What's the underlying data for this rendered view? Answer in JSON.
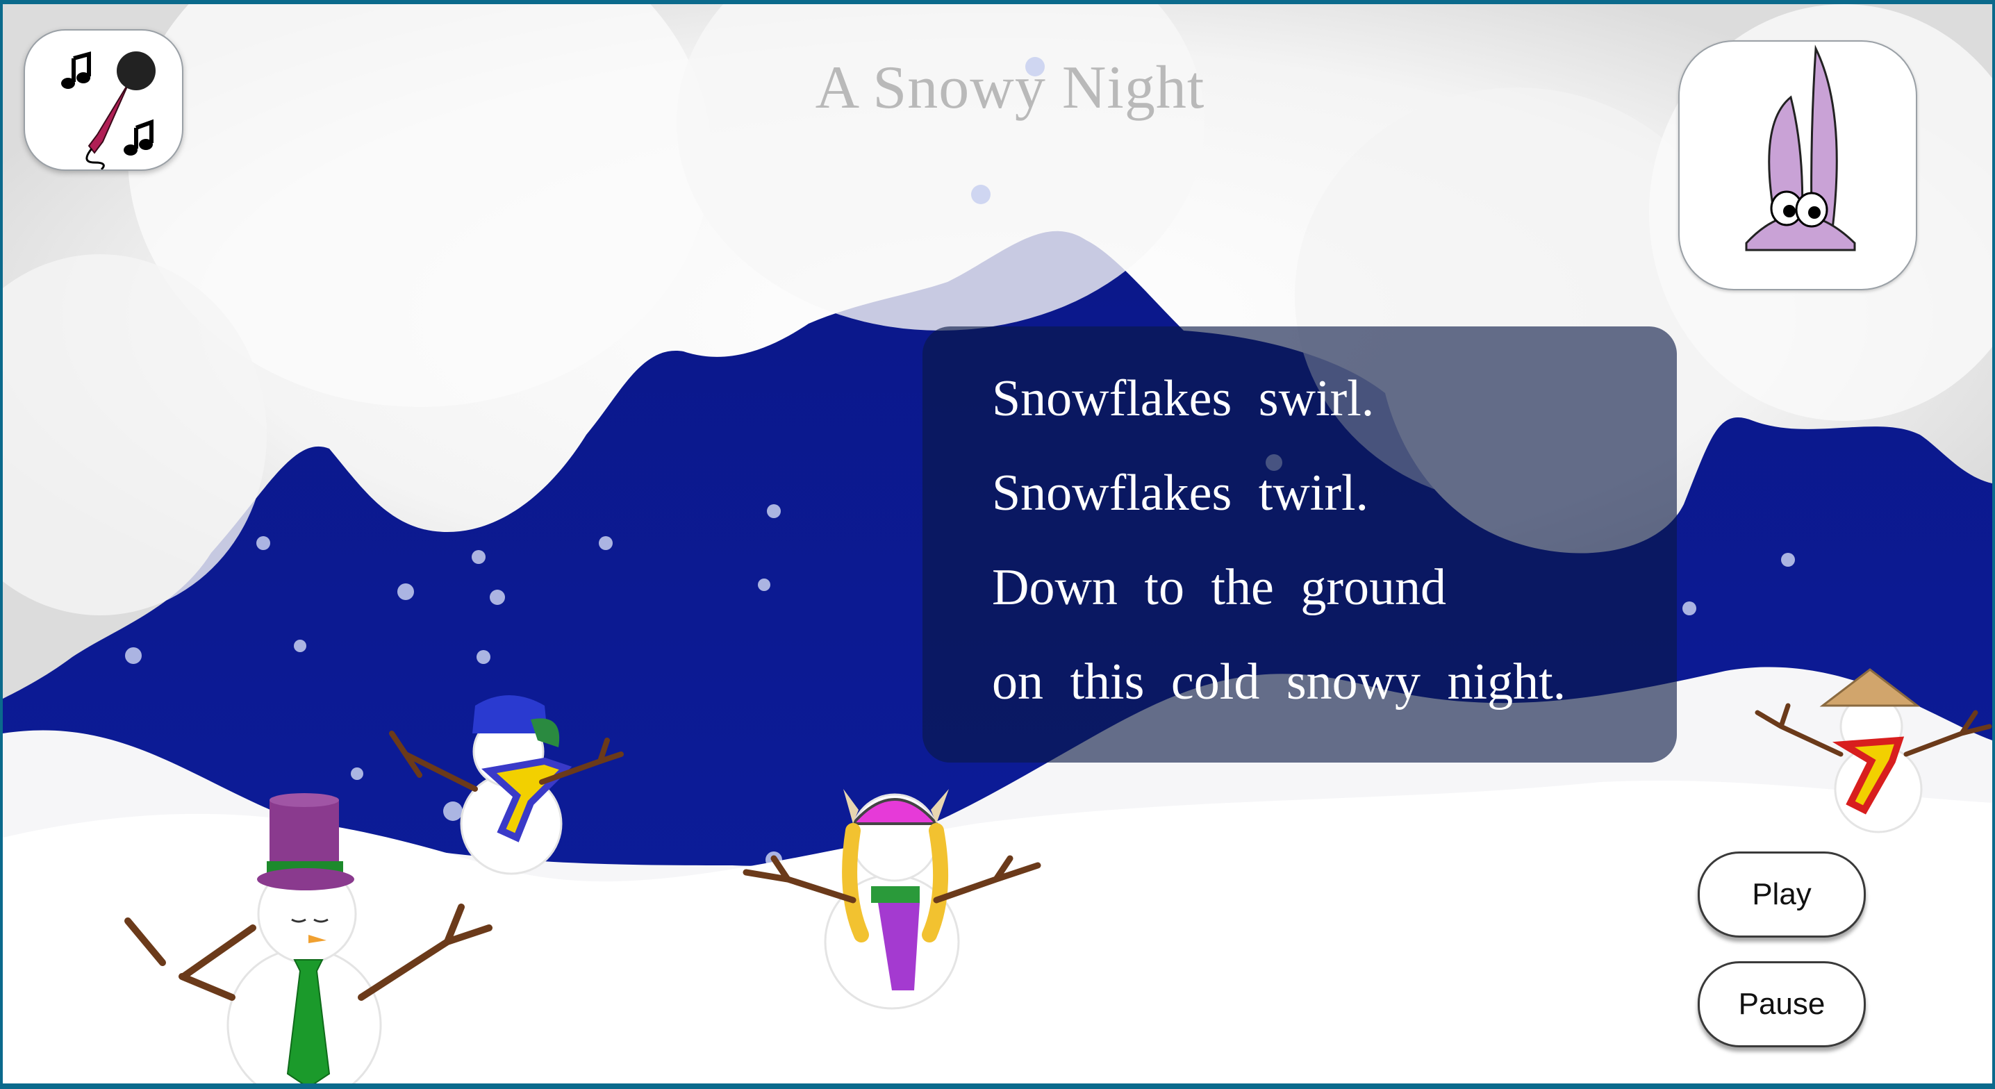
{
  "title": "A Snowy Night",
  "poem": {
    "lines": [
      "Snowflakes swirl.",
      "Snowflakes twirl.",
      "Down to the ground",
      "on this cold snowy night."
    ]
  },
  "controls": {
    "play_label": "Play",
    "pause_label": "Pause"
  },
  "icons": {
    "record": "microphone-music-icon",
    "character": "bunny-icon"
  },
  "colors": {
    "night_sky": "#0d1a8f",
    "snow": "#ffffff",
    "title": "#b9b9b9",
    "poem_panel": "#0a1846",
    "microphone": "#b01f55",
    "bunny": "#c9a2d6"
  }
}
